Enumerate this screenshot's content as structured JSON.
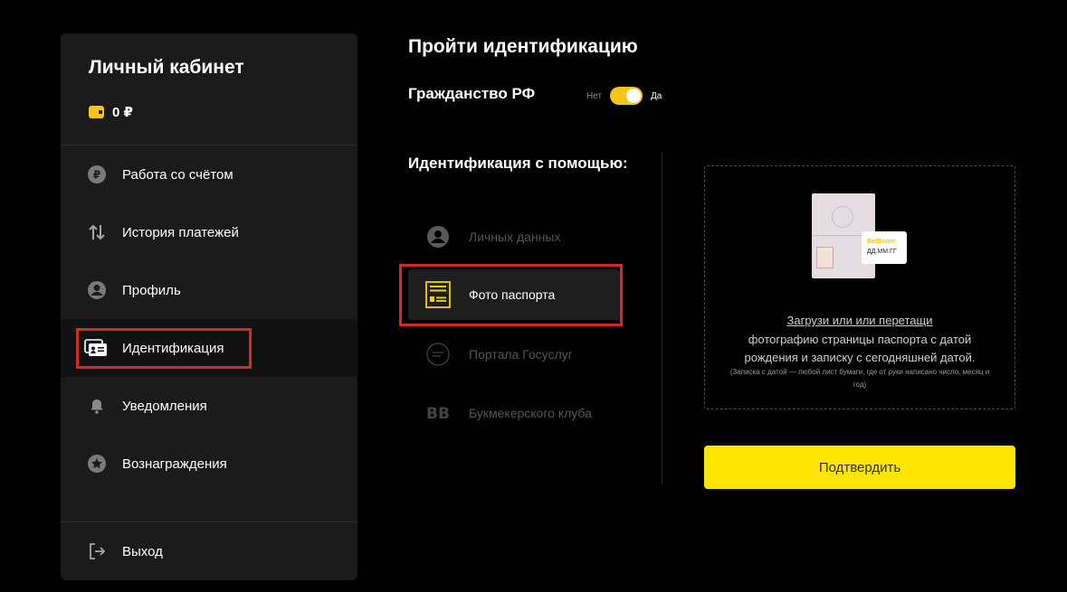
{
  "sidebar": {
    "title": "Личный кабинет",
    "balance": "0 ₽",
    "items": [
      {
        "label": "Работа со счётом",
        "icon": "ruble-circle-icon"
      },
      {
        "label": "История платежей",
        "icon": "arrows-up-down-icon"
      },
      {
        "label": "Профиль",
        "icon": "user-circle-icon"
      },
      {
        "label": "Идентификация",
        "icon": "id-card-icon",
        "active": true
      },
      {
        "label": "Уведомления",
        "icon": "bell-icon"
      },
      {
        "label": "Вознаграждения",
        "icon": "star-circle-icon"
      }
    ],
    "logout": "Выход"
  },
  "main": {
    "title": "Пройти идентификацию",
    "citizenship": {
      "label": "Гражданство РФ",
      "no": "Нет",
      "yes": "Да",
      "value": true
    },
    "method_heading": "Идентификация с помощью:",
    "methods": [
      {
        "label": "Личных данных",
        "icon": "user-circle-icon"
      },
      {
        "label": "Фото паспорта",
        "icon": "passport-icon",
        "active": true
      },
      {
        "label": "Портала Госуслуг",
        "icon": "gosuslugi-icon"
      },
      {
        "label": "Букмекерского клуба",
        "icon": "bb-logo-icon"
      }
    ],
    "upload": {
      "illustration_brand": "BetBoom",
      "illustration_date": "ДД.ММ.ГГ",
      "link": "Загрузи или или перетащи",
      "text": "фотографию страницы паспорта с датой рождения и записку с сегодняшней датой.",
      "note": "(Записка с датой — любой лист бумаги, где от руки написано число, месяц и год)"
    },
    "confirm_label": "Подтвердить"
  },
  "colors": {
    "accent": "#ffe600",
    "toggle": "#f5c518",
    "highlight": "#d02a2a",
    "sidebar_bg": "#1b1b1b",
    "page_bg": "#000000"
  }
}
